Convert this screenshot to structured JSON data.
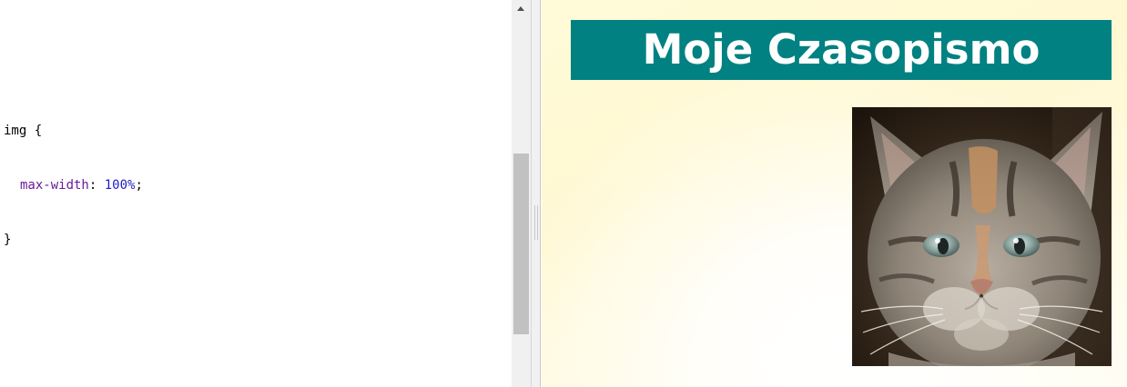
{
  "editor": {
    "code_lines": [
      {
        "selector": "img",
        "open": " {"
      },
      {
        "property": "max-width",
        "colon": ": ",
        "value": "100%",
        "semicolon": ";"
      },
      {
        "close": "}"
      }
    ]
  },
  "preview": {
    "heading": "Moje Czasopismo",
    "image_icon": "kitten-photo",
    "colors": {
      "banner": "#018181",
      "banner_text": "#ffffff",
      "background": "#fff8d2"
    }
  },
  "scrollbar": {
    "up_icon": "scroll-up-arrow-icon"
  }
}
